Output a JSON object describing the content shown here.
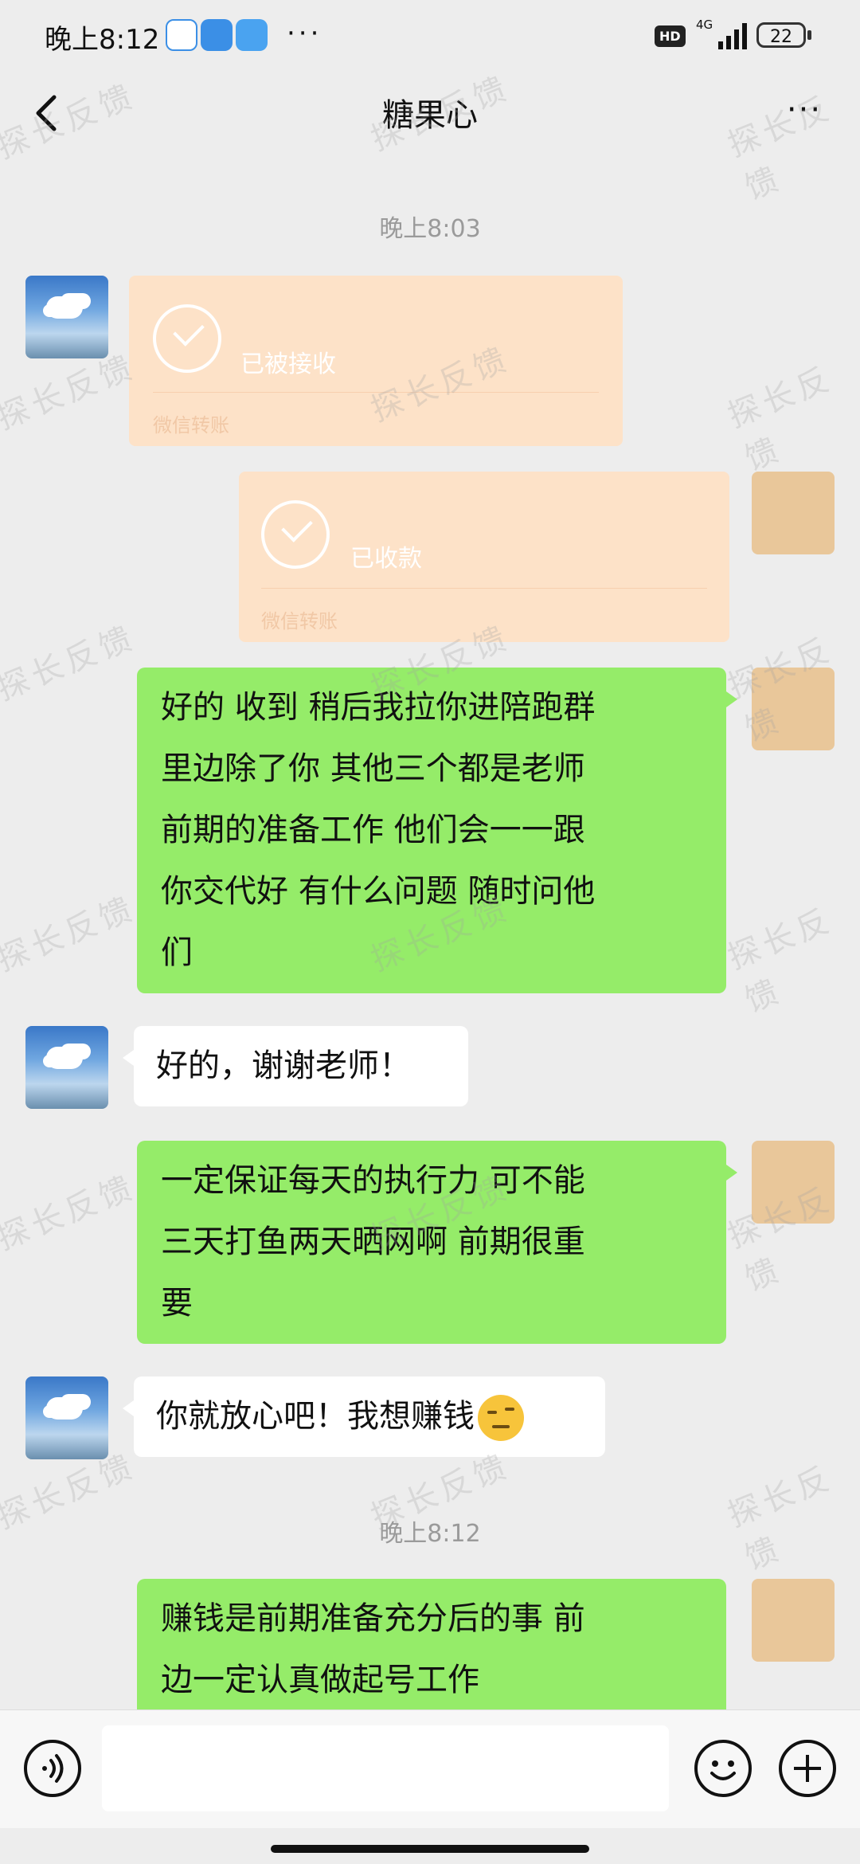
{
  "status_bar": {
    "time": "晚上8:12",
    "dots": "···",
    "hd": "HD",
    "network": "4G",
    "battery": "22"
  },
  "header": {
    "title": "糖果心",
    "more": "···"
  },
  "timestamps": [
    "晚上8:03",
    "晚上8:12"
  ],
  "transfers": [
    {
      "status": "已被接收",
      "footer": "微信转账"
    },
    {
      "status": "已收款",
      "footer": "微信转账"
    }
  ],
  "messages": [
    {
      "side": "right",
      "lines": [
        "好的 收到 稍后我拉你进陪跑群",
        "里边除了你 其他三个都是老师",
        "前期的准备工作 他们会一一跟",
        "你交代好 有什么问题 随时问他",
        "们"
      ]
    },
    {
      "side": "left",
      "lines": [
        "好的，谢谢老师！"
      ]
    },
    {
      "side": "right",
      "lines": [
        "一定保证每天的执行力 可不能",
        "三天打鱼两天晒网啊 前期很重",
        "要"
      ]
    },
    {
      "side": "left",
      "lines": [
        "你就放心吧！我想赚钱"
      ]
    },
    {
      "side": "right",
      "lines": [
        "赚钱是前期准备充分后的事 前",
        "边一定认真做起号工作"
      ]
    }
  ],
  "watermark": "探长反馈",
  "icons": {
    "back": "back-chevron-icon",
    "voice": "voice-icon",
    "emoji": "emoji-icon",
    "plus": "plus-icon"
  },
  "colors": {
    "background": "#ededed",
    "green_bubble": "#95ec69",
    "transfer_bg": "#fde2c8"
  }
}
